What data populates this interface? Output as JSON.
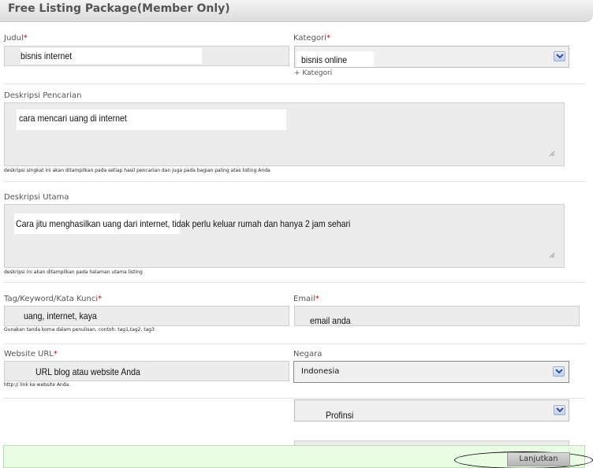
{
  "header": {
    "title": "Free Listing Package(Member Only)"
  },
  "form": {
    "judul": {
      "label": "Judul",
      "required_mark": "*",
      "value": "bisnis internet"
    },
    "kategori": {
      "label": "Kategori",
      "required_mark": "*",
      "value": "bisnis online",
      "add_link": "+ Kategori"
    },
    "deskripsi_pencarian": {
      "label": "Deskripsi Pencarian",
      "value": "cara mencari uang di internet",
      "hint": "deskripsi singkat ini akan ditampilkan pada setiap hasil pencarian dan juga pada bagian paling atas listing Anda"
    },
    "deskripsi_utama": {
      "label": "Deskripsi Utama",
      "value": "Cara jitu menghasilkan uang dari internet, tidak perlu keluar rumah dan hanya 2 jam sehari",
      "hint": "deskripsi ini akan ditampilkan pada halaman utama listing"
    },
    "tag": {
      "label": "Tag/Keyword/Kata Kunci",
      "required_mark": "*",
      "value": "uang, internet, kaya",
      "hint": "Gunakan tanda koma dalam penulisan, contoh: tag1,tag2, tag3"
    },
    "email": {
      "label": "Email",
      "required_mark": "*",
      "value": "email anda"
    },
    "website": {
      "label": "Website URL",
      "required_mark": "*",
      "value": "URL blog atau website Anda",
      "hint": "http:// link ke website Anda."
    },
    "negara": {
      "label": "Negara",
      "value": "Indonesia"
    },
    "provinsi": {
      "value": "Profinsi"
    }
  },
  "footer": {
    "submit_label": "Lanjutkan"
  },
  "colors": {
    "footer_bg": "#e9fce4",
    "required": "#cc0000",
    "select_arrow": "#2b4f9e"
  }
}
